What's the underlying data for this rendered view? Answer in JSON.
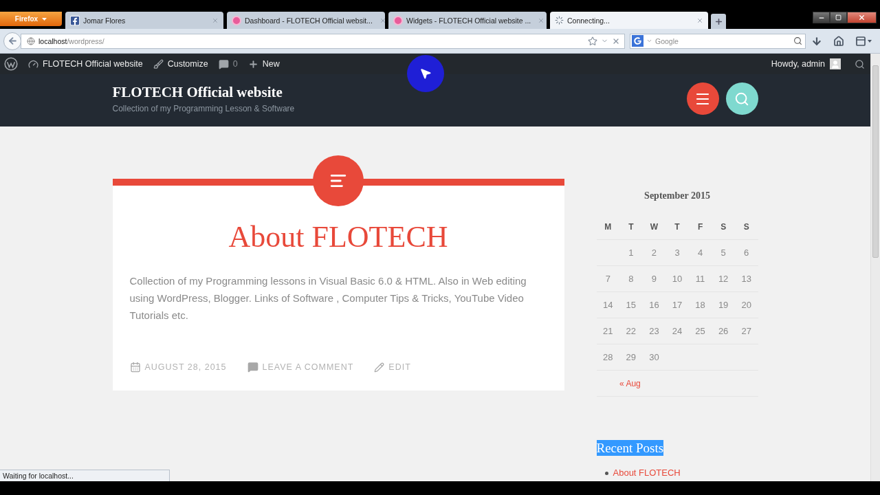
{
  "browser": {
    "menu_button": {
      "label": "Firefox"
    },
    "tabs": [
      {
        "title": "Jomar Flores",
        "kind": "facebook",
        "selected": false
      },
      {
        "title": "Dashboard - FLOTECH Official websit...",
        "kind": "wordpress",
        "selected": false
      },
      {
        "title": "Widgets - FLOTECH Official website ...",
        "kind": "wordpress",
        "selected": false
      },
      {
        "title": "Connecting...",
        "kind": "loading",
        "selected": true
      }
    ],
    "address_bar": {
      "host": "localhost",
      "path": "/wordpress/"
    },
    "search": {
      "placeholder": "Google"
    },
    "status": "Waiting for localhost..."
  },
  "admin_bar": {
    "site_name": "FLOTECH Official website",
    "customize": "Customize",
    "comments": "0",
    "new": "New",
    "greeting": "Howdy, admin"
  },
  "site_header": {
    "title": "FLOTECH Official website",
    "tagline": "Collection of my Programming Lesson & Software"
  },
  "post": {
    "title": "About FLOTECH",
    "excerpt": "Collection of my Programming lessons in Visual Basic 6.0 & HTML. Also in Web editing using WordPress, Blogger. Links of Software , Computer Tips & Tricks, YouTube Video Tutorials etc.",
    "meta": [
      {
        "kind": "date",
        "label": "AUGUST 28, 2015"
      },
      {
        "kind": "comments",
        "label": "LEAVE A COMMENT"
      },
      {
        "kind": "edit",
        "label": "EDIT"
      }
    ]
  },
  "sidebar": {
    "calendar": {
      "caption": "September 2015",
      "weekdays": [
        "M",
        "T",
        "W",
        "T",
        "F",
        "S",
        "S"
      ],
      "weeks": [
        [
          {
            "kind": "blank"
          },
          {
            "kind": "day",
            "label": "1"
          },
          {
            "kind": "day",
            "label": "2"
          },
          {
            "kind": "day",
            "label": "3"
          },
          {
            "kind": "day",
            "label": "4"
          },
          {
            "kind": "day",
            "label": "5"
          },
          {
            "kind": "day",
            "label": "6"
          }
        ],
        [
          {
            "kind": "day",
            "label": "7"
          },
          {
            "kind": "day",
            "label": "8"
          },
          {
            "kind": "day",
            "label": "9"
          },
          {
            "kind": "day",
            "label": "10"
          },
          {
            "kind": "day",
            "label": "11"
          },
          {
            "kind": "day",
            "label": "12"
          },
          {
            "kind": "day",
            "label": "13"
          }
        ],
        [
          {
            "kind": "day",
            "label": "14"
          },
          {
            "kind": "day",
            "label": "15"
          },
          {
            "kind": "day",
            "label": "16"
          },
          {
            "kind": "day",
            "label": "17"
          },
          {
            "kind": "day",
            "label": "18"
          },
          {
            "kind": "day",
            "label": "19"
          },
          {
            "kind": "day",
            "label": "20"
          }
        ],
        [
          {
            "kind": "day",
            "label": "21"
          },
          {
            "kind": "day",
            "label": "22"
          },
          {
            "kind": "day",
            "label": "23"
          },
          {
            "kind": "day",
            "label": "24"
          },
          {
            "kind": "day",
            "label": "25"
          },
          {
            "kind": "day",
            "label": "26"
          },
          {
            "kind": "day",
            "label": "27"
          }
        ],
        [
          {
            "kind": "day",
            "label": "28"
          },
          {
            "kind": "day",
            "label": "29"
          },
          {
            "kind": "day",
            "label": "30"
          }
        ]
      ],
      "prev_link": "« Aug"
    },
    "recent_posts": {
      "heading": "Recent Posts",
      "text_selected": true,
      "items": [
        "About FLOTECH"
      ]
    }
  }
}
